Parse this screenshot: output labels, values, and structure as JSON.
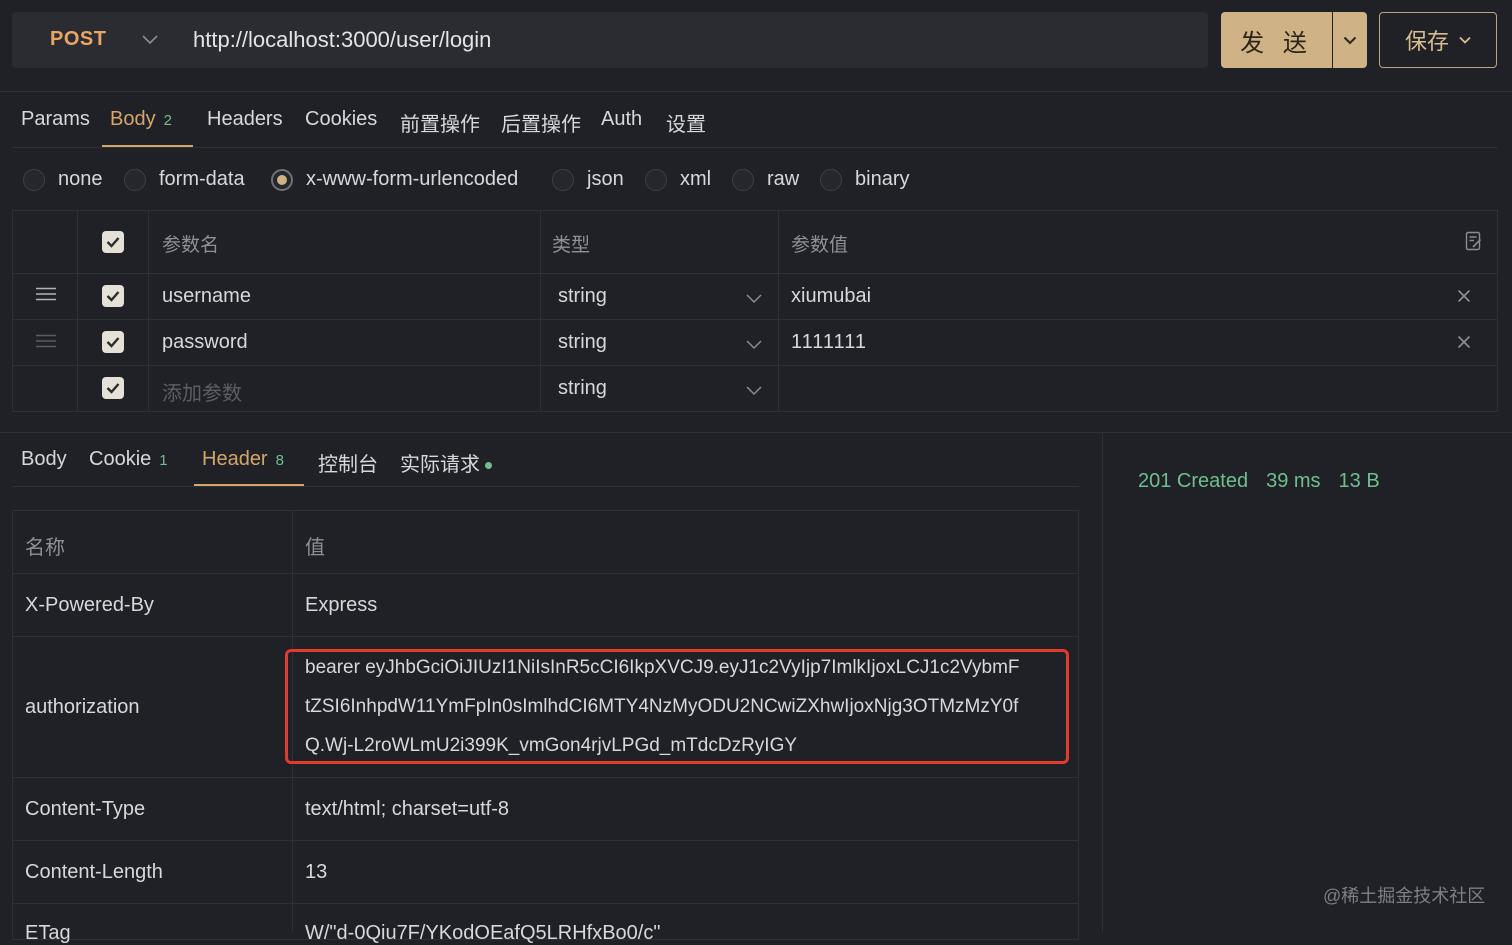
{
  "request": {
    "method": "POST",
    "url": "http://localhost:3000/user/login",
    "send_label": "发 送",
    "save_label": "保存"
  },
  "request_tabs": [
    {
      "label": "Params"
    },
    {
      "label": "Body",
      "count": "2"
    },
    {
      "label": "Headers"
    },
    {
      "label": "Cookies"
    },
    {
      "label": "前置操作"
    },
    {
      "label": "后置操作"
    },
    {
      "label": "Auth"
    },
    {
      "label": "设置"
    }
  ],
  "body_types": [
    "none",
    "form-data",
    "x-www-form-urlencoded",
    "json",
    "xml",
    "raw",
    "binary"
  ],
  "body_type_selected": "x-www-form-urlencoded",
  "params_table": {
    "headers": [
      "参数名",
      "类型",
      "参数值"
    ],
    "rows": [
      {
        "name": "username",
        "type": "string",
        "value": "xiumubai"
      },
      {
        "name": "password",
        "type": "string",
        "value": "1111111"
      }
    ],
    "add_placeholder": "添加参数",
    "add_type": "string"
  },
  "response_tabs": [
    {
      "label": "Body"
    },
    {
      "label": "Cookie",
      "count": "1"
    },
    {
      "label": "Header",
      "count": "8"
    },
    {
      "label": "控制台"
    },
    {
      "label": "实际请求"
    }
  ],
  "response_headers": {
    "columns": [
      "名称",
      "值"
    ],
    "rows": [
      {
        "name": "X-Powered-By",
        "value": "Express"
      },
      {
        "name": "authorization",
        "value_lines": [
          "bearer eyJhbGciOiJIUzI1NiIsInR5cCI6IkpXVCJ9.eyJ1c2VyIjp7ImlkIjoxLCJ1c2VybmF",
          "tZSI6InhpdW11YmFpIn0sImlhdCI6MTY4NzMyODU2NCwiZXhwIjoxNjg3OTMzMzY0f",
          "Q.Wj-L2roWLmU2i399K_vmGon4rjvLPGd_mTdcDzRyIGY"
        ]
      },
      {
        "name": "Content-Type",
        "value": "text/html; charset=utf-8"
      },
      {
        "name": "Content-Length",
        "value": "13"
      },
      {
        "name": "ETag",
        "value": "W/\"d-0Qiu7F/YKodOEafQ5LRHfxBo0/c\""
      }
    ]
  },
  "response_status": {
    "status": "201 Created",
    "time": "39 ms",
    "size": "13 B"
  },
  "watermark": "@稀土掘金技术社区",
  "colors": {
    "accent": "#d4a66a",
    "success": "#6fbf8e",
    "highlight": "#e33a2f",
    "background": "#1f2126"
  }
}
